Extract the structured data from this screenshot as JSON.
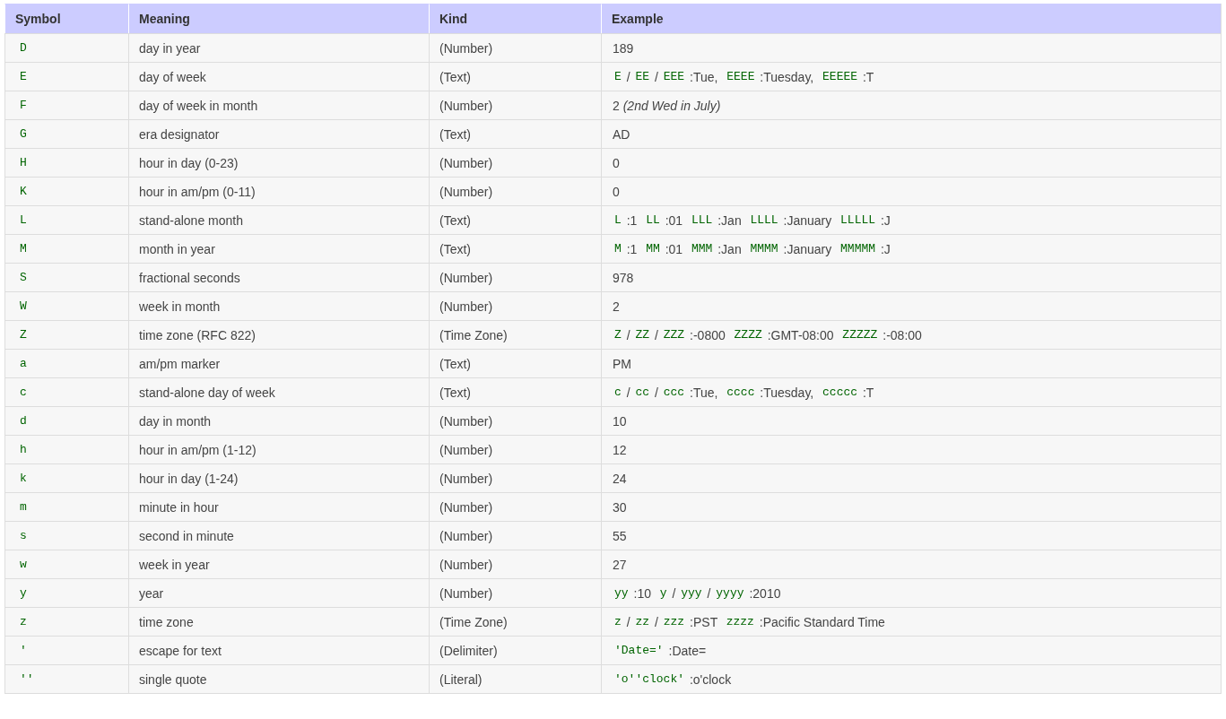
{
  "table": {
    "columns": [
      "Symbol",
      "Meaning",
      "Kind",
      "Example"
    ],
    "rows": [
      {
        "symbol": "D",
        "meaning": "day in year",
        "kind": "(Number)",
        "example": [
          {
            "kind": "text",
            "text": "189"
          }
        ]
      },
      {
        "symbol": "E",
        "meaning": "day of week",
        "kind": "(Text)",
        "example": [
          {
            "kind": "code",
            "text": "E"
          },
          {
            "kind": "text",
            "text": " / "
          },
          {
            "kind": "code",
            "text": "EE"
          },
          {
            "kind": "text",
            "text": " / "
          },
          {
            "kind": "code",
            "text": "EEE"
          },
          {
            "kind": "text",
            "text": " :Tue,  "
          },
          {
            "kind": "code",
            "text": "EEEE"
          },
          {
            "kind": "text",
            "text": " :Tuesday,  "
          },
          {
            "kind": "code",
            "text": "EEEEE"
          },
          {
            "kind": "text",
            "text": " :T"
          }
        ]
      },
      {
        "symbol": "F",
        "meaning": "day of week in month",
        "kind": "(Number)",
        "example": [
          {
            "kind": "text",
            "text": "2 "
          },
          {
            "kind": "italic",
            "text": "(2nd Wed in July)"
          }
        ]
      },
      {
        "symbol": "G",
        "meaning": "era designator",
        "kind": "(Text)",
        "example": [
          {
            "kind": "text",
            "text": "AD"
          }
        ]
      },
      {
        "symbol": "H",
        "meaning": "hour in day (0-23)",
        "kind": "(Number)",
        "example": [
          {
            "kind": "text",
            "text": "0"
          }
        ]
      },
      {
        "symbol": "K",
        "meaning": "hour in am/pm (0-11)",
        "kind": "(Number)",
        "example": [
          {
            "kind": "text",
            "text": "0"
          }
        ]
      },
      {
        "symbol": "L",
        "meaning": "stand-alone month",
        "kind": "(Text)",
        "example": [
          {
            "kind": "code",
            "text": "L"
          },
          {
            "kind": "text",
            "text": " :1  "
          },
          {
            "kind": "code",
            "text": "LL"
          },
          {
            "kind": "text",
            "text": " :01  "
          },
          {
            "kind": "code",
            "text": "LLL"
          },
          {
            "kind": "text",
            "text": " :Jan  "
          },
          {
            "kind": "code",
            "text": "LLLL"
          },
          {
            "kind": "text",
            "text": " :January  "
          },
          {
            "kind": "code",
            "text": "LLLLL"
          },
          {
            "kind": "text",
            "text": " :J"
          }
        ]
      },
      {
        "symbol": "M",
        "meaning": "month in year",
        "kind": "(Text)",
        "example": [
          {
            "kind": "code",
            "text": "M"
          },
          {
            "kind": "text",
            "text": " :1  "
          },
          {
            "kind": "code",
            "text": "MM"
          },
          {
            "kind": "text",
            "text": " :01  "
          },
          {
            "kind": "code",
            "text": "MMM"
          },
          {
            "kind": "text",
            "text": " :Jan  "
          },
          {
            "kind": "code",
            "text": "MMMM"
          },
          {
            "kind": "text",
            "text": " :January  "
          },
          {
            "kind": "code",
            "text": "MMMMM"
          },
          {
            "kind": "text",
            "text": " :J"
          }
        ]
      },
      {
        "symbol": "S",
        "meaning": "fractional seconds",
        "kind": "(Number)",
        "example": [
          {
            "kind": "text",
            "text": "978"
          }
        ]
      },
      {
        "symbol": "W",
        "meaning": "week in month",
        "kind": "(Number)",
        "example": [
          {
            "kind": "text",
            "text": "2"
          }
        ]
      },
      {
        "symbol": "Z",
        "meaning": "time zone (RFC 822)",
        "kind": "(Time Zone)",
        "example": [
          {
            "kind": "code",
            "text": "Z"
          },
          {
            "kind": "text",
            "text": " / "
          },
          {
            "kind": "code",
            "text": "ZZ"
          },
          {
            "kind": "text",
            "text": " / "
          },
          {
            "kind": "code",
            "text": "ZZZ"
          },
          {
            "kind": "text",
            "text": " :-0800  "
          },
          {
            "kind": "code",
            "text": "ZZZZ"
          },
          {
            "kind": "text",
            "text": " :GMT-08:00  "
          },
          {
            "kind": "code",
            "text": "ZZZZZ"
          },
          {
            "kind": "text",
            "text": " :-08:00"
          }
        ]
      },
      {
        "symbol": "a",
        "meaning": "am/pm marker",
        "kind": "(Text)",
        "example": [
          {
            "kind": "text",
            "text": "PM"
          }
        ]
      },
      {
        "symbol": "c",
        "meaning": "stand-alone day of week",
        "kind": "(Text)",
        "example": [
          {
            "kind": "code",
            "text": "c"
          },
          {
            "kind": "text",
            "text": " / "
          },
          {
            "kind": "code",
            "text": "cc"
          },
          {
            "kind": "text",
            "text": " / "
          },
          {
            "kind": "code",
            "text": "ccc"
          },
          {
            "kind": "text",
            "text": " :Tue,  "
          },
          {
            "kind": "code",
            "text": "cccc"
          },
          {
            "kind": "text",
            "text": " :Tuesday,  "
          },
          {
            "kind": "code",
            "text": "ccccc"
          },
          {
            "kind": "text",
            "text": " :T"
          }
        ]
      },
      {
        "symbol": "d",
        "meaning": "day in month",
        "kind": "(Number)",
        "example": [
          {
            "kind": "text",
            "text": "10"
          }
        ]
      },
      {
        "symbol": "h",
        "meaning": "hour in am/pm (1-12)",
        "kind": "(Number)",
        "example": [
          {
            "kind": "text",
            "text": "12"
          }
        ]
      },
      {
        "symbol": "k",
        "meaning": "hour in day (1-24)",
        "kind": "(Number)",
        "example": [
          {
            "kind": "text",
            "text": "24"
          }
        ]
      },
      {
        "symbol": "m",
        "meaning": "minute in hour",
        "kind": "(Number)",
        "example": [
          {
            "kind": "text",
            "text": "30"
          }
        ]
      },
      {
        "symbol": "s",
        "meaning": "second in minute",
        "kind": "(Number)",
        "example": [
          {
            "kind": "text",
            "text": "55"
          }
        ]
      },
      {
        "symbol": "w",
        "meaning": "week in year",
        "kind": "(Number)",
        "example": [
          {
            "kind": "text",
            "text": "27"
          }
        ]
      },
      {
        "symbol": "y",
        "meaning": "year",
        "kind": "(Number)",
        "example": [
          {
            "kind": "code",
            "text": "yy"
          },
          {
            "kind": "text",
            "text": " :10  "
          },
          {
            "kind": "code",
            "text": "y"
          },
          {
            "kind": "text",
            "text": " / "
          },
          {
            "kind": "code",
            "text": "yyy"
          },
          {
            "kind": "text",
            "text": " / "
          },
          {
            "kind": "code",
            "text": "yyyy"
          },
          {
            "kind": "text",
            "text": " :2010"
          }
        ]
      },
      {
        "symbol": "z",
        "meaning": "time zone",
        "kind": "(Time Zone)",
        "example": [
          {
            "kind": "code",
            "text": "z"
          },
          {
            "kind": "text",
            "text": " / "
          },
          {
            "kind": "code",
            "text": "zz"
          },
          {
            "kind": "text",
            "text": " / "
          },
          {
            "kind": "code",
            "text": "zzz"
          },
          {
            "kind": "text",
            "text": " :PST  "
          },
          {
            "kind": "code",
            "text": "zzzz"
          },
          {
            "kind": "text",
            "text": " :Pacific Standard Time"
          }
        ]
      },
      {
        "symbol": "'",
        "meaning": "escape for text",
        "kind": "(Delimiter)",
        "example": [
          {
            "kind": "code",
            "text": "'Date='"
          },
          {
            "kind": "text",
            "text": " :Date="
          }
        ]
      },
      {
        "symbol": "''",
        "meaning": "single quote",
        "kind": "(Literal)",
        "example": [
          {
            "kind": "code",
            "text": "'o''clock'"
          },
          {
            "kind": "text",
            "text": " :o'clock"
          }
        ]
      }
    ]
  }
}
